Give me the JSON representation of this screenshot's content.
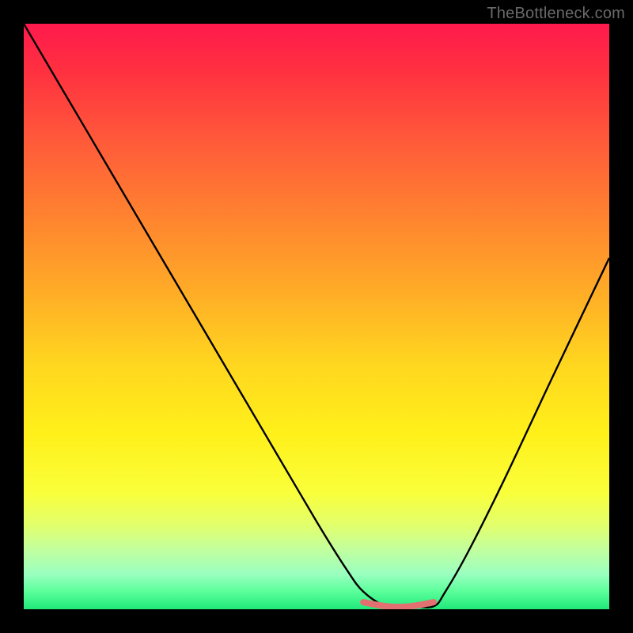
{
  "watermark": "TheBottleneck.com",
  "chart_data": {
    "type": "line",
    "title": "",
    "xlabel": "",
    "ylabel": "",
    "xlim": [
      0,
      100
    ],
    "ylim": [
      0,
      100
    ],
    "background_gradient": {
      "top_color": "#ff1a4d",
      "bottom_color": "#20e87a",
      "meaning": "red = high bottleneck, green = low bottleneck"
    },
    "series": [
      {
        "name": "bottleneck-curve",
        "color": "#000000",
        "x": [
          0,
          10,
          20,
          30,
          40,
          50,
          55,
          58,
          62,
          66,
          70,
          72,
          76,
          82,
          90,
          100
        ],
        "values": [
          100,
          83,
          66,
          49,
          32,
          15,
          7,
          3,
          0.5,
          0.5,
          0.5,
          3,
          10,
          22,
          39,
          60
        ]
      },
      {
        "name": "optimal-range-marker",
        "color": "#e27070",
        "x": [
          58,
          62,
          66,
          70
        ],
        "values": [
          1.2,
          0.5,
          0.5,
          1.2
        ]
      }
    ],
    "annotations": []
  }
}
